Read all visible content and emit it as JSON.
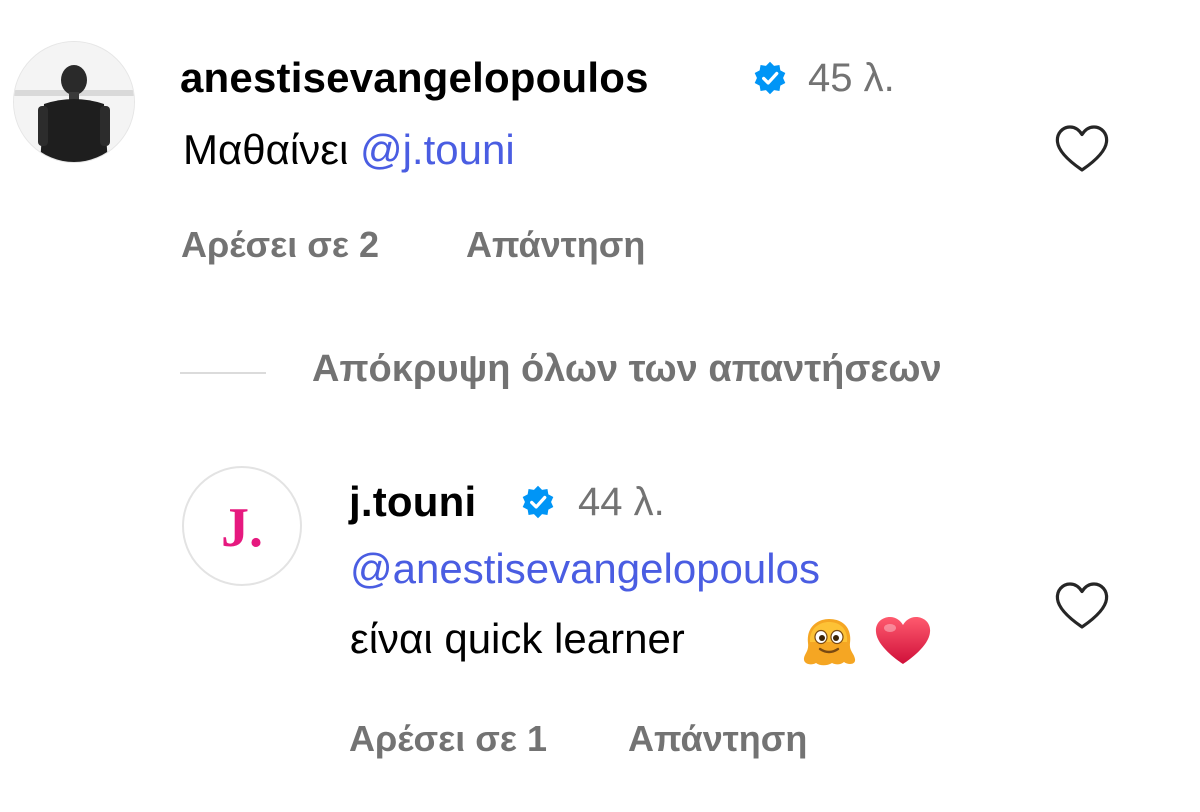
{
  "comments": [
    {
      "username": "anestisevangelopoulos",
      "time": "45 λ.",
      "text": "Μαθαίνει ",
      "mention": "@j.touni",
      "likes": "Αρέσει σε 2",
      "reply": "Απάντηση"
    },
    {
      "username": "j.touni",
      "avatar_logo": "J.",
      "time": "44 λ.",
      "mention": "@anestisevangelopoulos",
      "text": "είναι quick learner",
      "likes": "Αρέσει σε 1",
      "reply": "Απάντηση"
    }
  ],
  "hide_replies": "Απόκρυψη όλων των απαντήσεων",
  "colors": {
    "verified": "#0095f6",
    "mention": "#4a5de2",
    "secondary": "#737373",
    "brand_pink": "#e6197f"
  }
}
